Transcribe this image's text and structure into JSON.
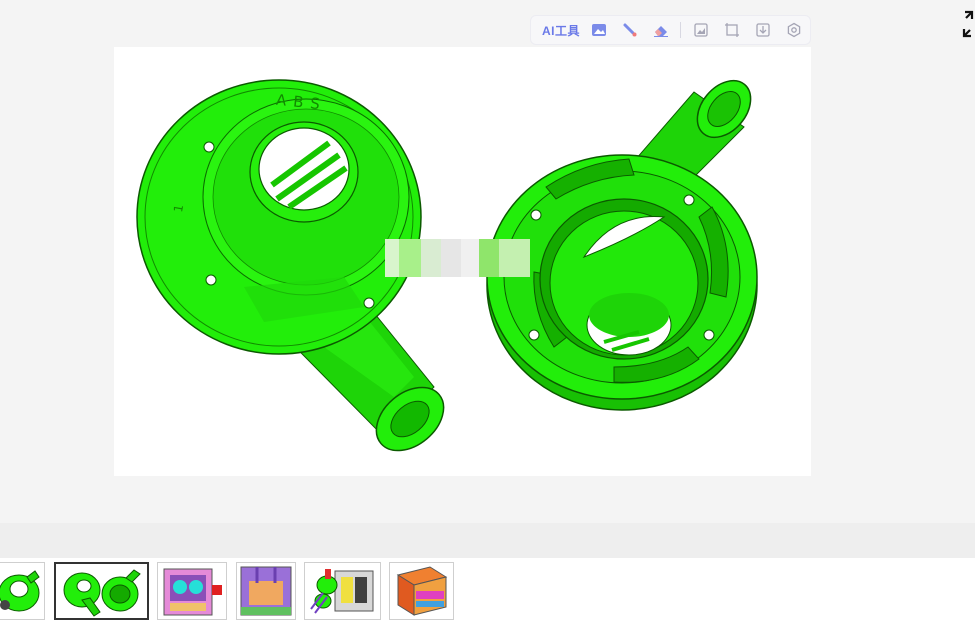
{
  "toolbar": {
    "ai_tools_label": "AI工具",
    "icons": [
      "image-icon",
      "brush-icon",
      "eraser-icon",
      "picture-edit-icon",
      "crop-icon",
      "download-icon",
      "settings-icon"
    ]
  },
  "canvas": {
    "emboss_text": "ABS",
    "emboss_number": "1"
  },
  "colors": {
    "part_green": "#22ee0a",
    "accent_blue": "#6a79e8",
    "background": "#f4f4f4",
    "canvas": "#ffffff",
    "band": "#eeeeee",
    "thumb_border_active": "#333333"
  },
  "thumbnails": {
    "items": [
      "green-part",
      "green-part-pair",
      "pink-mold",
      "purple-mold",
      "mold-assembly",
      "orange-mold"
    ],
    "active_index": 1
  }
}
